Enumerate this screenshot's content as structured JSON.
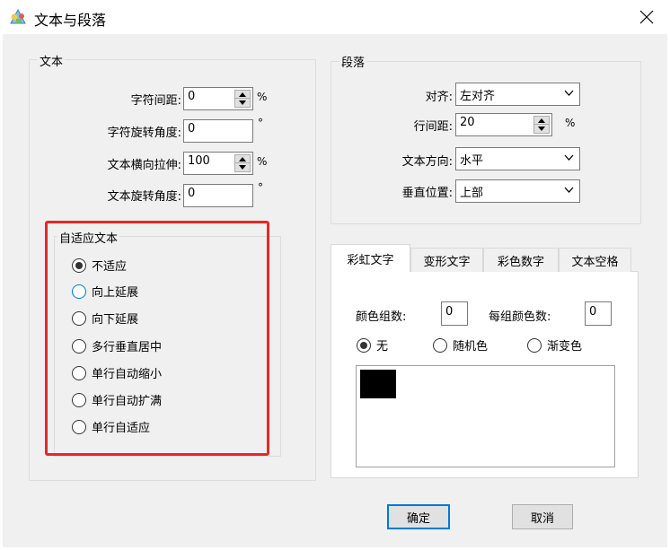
{
  "window": {
    "title": "文本与段落",
    "close_glyph": "✕"
  },
  "text_group": {
    "label": "文本",
    "char_spacing": {
      "label": "字符间距:",
      "value": "0",
      "unit": "%"
    },
    "char_rotation": {
      "label": "字符旋转角度:",
      "value": "0",
      "unit": "°"
    },
    "text_stretch": {
      "label": "文本横向拉伸:",
      "value": "100",
      "unit": "%"
    },
    "text_rotation": {
      "label": "文本旋转角度:",
      "value": "0",
      "unit": "°"
    }
  },
  "autofit_group": {
    "label": "自适应文本",
    "options": [
      {
        "label": "不适应",
        "selected": true
      },
      {
        "label": "向上延展",
        "selected": false
      },
      {
        "label": "向下延展",
        "selected": false
      },
      {
        "label": "多行垂直居中",
        "selected": false
      },
      {
        "label": "单行自动缩小",
        "selected": false
      },
      {
        "label": "单行自动扩满",
        "selected": false
      },
      {
        "label": "单行自适应",
        "selected": false
      }
    ]
  },
  "paragraph_group": {
    "label": "段落",
    "align": {
      "label": "对齐:",
      "value": "左对齐"
    },
    "line_spacing": {
      "label": "行间距:",
      "value": "20",
      "unit": "%"
    },
    "text_direction": {
      "label": "文本方向:",
      "value": "水平"
    },
    "vertical_position": {
      "label": "垂直位置:",
      "value": "上部"
    }
  },
  "tabs": [
    {
      "label": "彩虹文字",
      "active": true
    },
    {
      "label": "变形文字",
      "active": false
    },
    {
      "label": "彩色数字",
      "active": false
    },
    {
      "label": "文本空格",
      "active": false
    }
  ],
  "rainbow": {
    "color_groups": {
      "label": "颜色组数:",
      "value": "0"
    },
    "colors_per_group": {
      "label": "每组颜色数:",
      "value": "0"
    },
    "mode_options": [
      {
        "label": "无",
        "selected": true
      },
      {
        "label": "随机色",
        "selected": false
      },
      {
        "label": "渐变色",
        "selected": false
      }
    ],
    "swatch_color": "#000000"
  },
  "buttons": {
    "ok": "确定",
    "cancel": "取消"
  },
  "colors": {
    "highlight": "#e8262a",
    "focus": "#0078d7",
    "dialog_bg": "#f0f0f0"
  }
}
